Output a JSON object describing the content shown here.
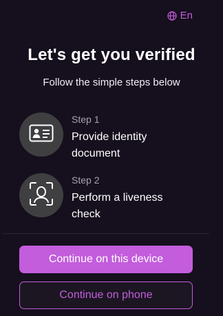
{
  "language": {
    "label": "En",
    "icon": "globe-icon"
  },
  "heading": {
    "title": "Let's get you verified",
    "subtitle": "Follow the simple steps below"
  },
  "steps": [
    {
      "number": "Step 1",
      "description": "Provide identity document",
      "icon": "id-card-icon"
    },
    {
      "number": "Step 2",
      "description": "Perform a liveness check",
      "icon": "face-scan-icon"
    }
  ],
  "actions": {
    "primary_label": "Continue on this device",
    "secondary_label": "Continue on phone"
  },
  "colors": {
    "accent": "#c35ddc",
    "background": "#160f1d",
    "icon_circle": "#3f3f41"
  }
}
